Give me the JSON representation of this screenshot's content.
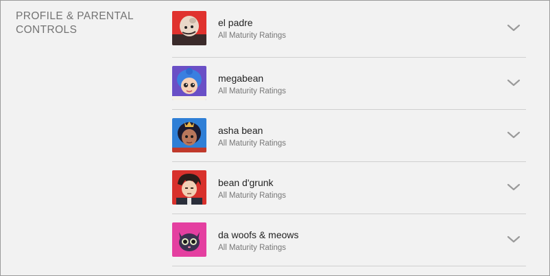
{
  "section": {
    "title": "PROFILE & PARENTAL CONTROLS"
  },
  "profiles": [
    {
      "name": "el padre",
      "rating": "All Maturity Ratings",
      "avatar_color": "#e0322e",
      "icon": "bald-character-avatar"
    },
    {
      "name": "megabean",
      "rating": "All Maturity Ratings",
      "avatar_color": "#6a4fc6",
      "icon": "blue-haired-girl-avatar"
    },
    {
      "name": "asha bean",
      "rating": "All Maturity Ratings",
      "avatar_color": "#2f7fd6",
      "icon": "princess-avatar"
    },
    {
      "name": "bean d'grunk",
      "rating": "All Maturity Ratings",
      "avatar_color": "#d8312c",
      "icon": "anime-boy-avatar"
    },
    {
      "name": "da woofs & meows",
      "rating": "All Maturity Ratings",
      "avatar_color": "#e43fa0",
      "icon": "black-cat-avatar"
    }
  ]
}
